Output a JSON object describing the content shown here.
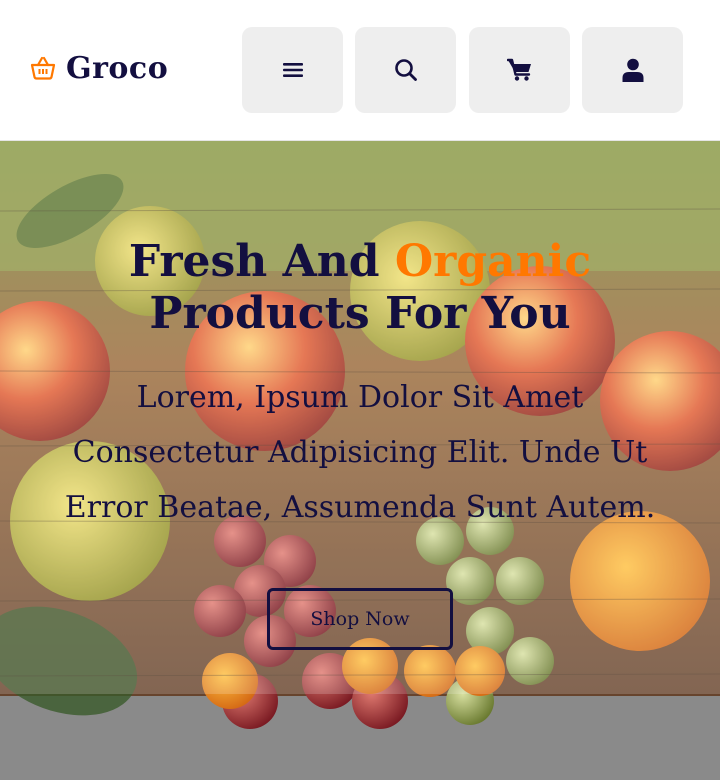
{
  "header": {
    "logo_text": "Groco",
    "logo_icon": "basket-icon",
    "menu_icon": "menu-icon",
    "search_icon": "search-icon",
    "cart_icon": "cart-icon",
    "user_icon": "user-icon"
  },
  "hero": {
    "title_part1": "Fresh And ",
    "title_accent": "Organic",
    "title_part2": " Products For You",
    "description": "Lorem, Ipsum Dolor Sit Amet Consectetur Adipisicing Elit. Unde Ut Error Beatae, Assumenda Sunt Autem.",
    "button_label": "Shop Now",
    "background": "fruit-basket-photo"
  },
  "colors": {
    "brand_dark": "#130f40",
    "accent": "#ff7800",
    "icon_button_bg": "#eeeeee"
  }
}
